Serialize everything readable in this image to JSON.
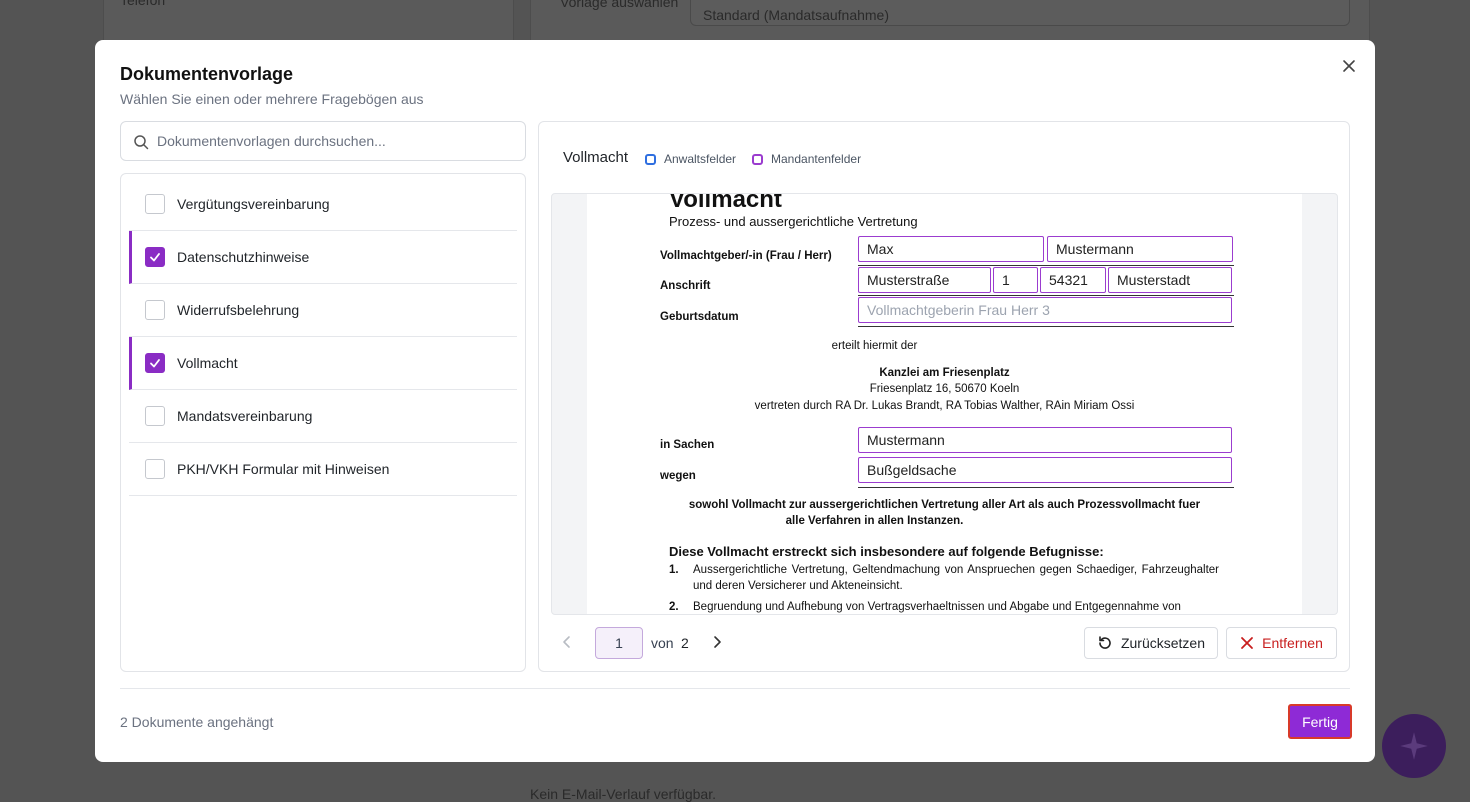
{
  "background": {
    "phone_label": "Telefon",
    "template_label": "Vorlage auswählen",
    "template_value": "Standard (Mandatsaufnahme)",
    "email_empty": "Kein E-Mail-Verlauf verfügbar."
  },
  "modal": {
    "title": "Dokumentenvorlage",
    "subtitle": "Wählen Sie einen oder mehrere Fragebögen aus",
    "search_placeholder": "Dokumentenvorlagen durchsuchen...",
    "templates": [
      {
        "label": "Vergütungsvereinbarung",
        "checked": false
      },
      {
        "label": "Datenschutzhinweise",
        "checked": true
      },
      {
        "label": "Widerrufsbelehrung",
        "checked": false
      },
      {
        "label": "Vollmacht",
        "checked": true
      },
      {
        "label": "Mandatsvereinbarung",
        "checked": false
      },
      {
        "label": "PKH/VKH Formular mit Hinweisen",
        "checked": false
      }
    ],
    "preview": {
      "title": "Vollmacht",
      "legend_lawyer": "Anwaltsfelder",
      "legend_client": "Mandantenfelder",
      "colors": {
        "lawyer": "#2f6fe0",
        "client": "#9b3ccf",
        "accent": "#8e2ad6"
      },
      "document": {
        "heading": "Vollmacht",
        "subheading": "Prozess- und aussergerichtliche Vertretung",
        "label_grantor": "Vollmachtgeber/-in (Frau / Herr)",
        "label_address": "Anschrift",
        "label_birthdate": "Geburtsdatum",
        "field_first_name": "Max",
        "field_last_name": "Mustermann",
        "field_street": "Musterstraße",
        "field_house_no": "1",
        "field_zip": "54321",
        "field_city": "Musterstadt",
        "field_birthdate_placeholder": "Vollmachtgeberin Frau Herr 3",
        "grants_text": "erteilt hiermit der",
        "firm_name": "Kanzlei am Friesenplatz",
        "firm_address": "Friesenplatz 16, 50670 Koeln",
        "firm_represented": "vertreten durch RA Dr. Lukas Brandt, RA Tobias Walther, RAin Miriam Ossi",
        "label_matter": "in Sachen",
        "label_reason": "wegen",
        "field_matter": "Mustermann",
        "field_reason": "Bußgeldsache",
        "scope_line1": "sowohl Vollmacht zur aussergerichtlichen Vertretung aller Art als auch Prozessvollmacht fuer",
        "scope_line2": "alle Verfahren in allen Instanzen.",
        "powers_heading": "Diese Vollmacht erstreckt sich insbesondere auf folgende Befugnisse:",
        "power1_num": "1.",
        "power1_text": "Aussergerichtliche Vertretung, Geltendmachung von Anspruechen gegen Schaediger, Fahrzeughalter und deren Versicherer und Akteneinsicht.",
        "power2_num": "2.",
        "power2_text": "Begruendung und Aufhebung von Vertragsverhaeltnissen und Abgabe und Entgegennahme von"
      },
      "pagination": {
        "current": "1",
        "of_label": "von",
        "total": "2"
      },
      "reset_label": "Zurücksetzen",
      "remove_label": "Entfernen"
    },
    "footer_status": "2 Dokumente angehängt",
    "done_label": "Fertig"
  }
}
